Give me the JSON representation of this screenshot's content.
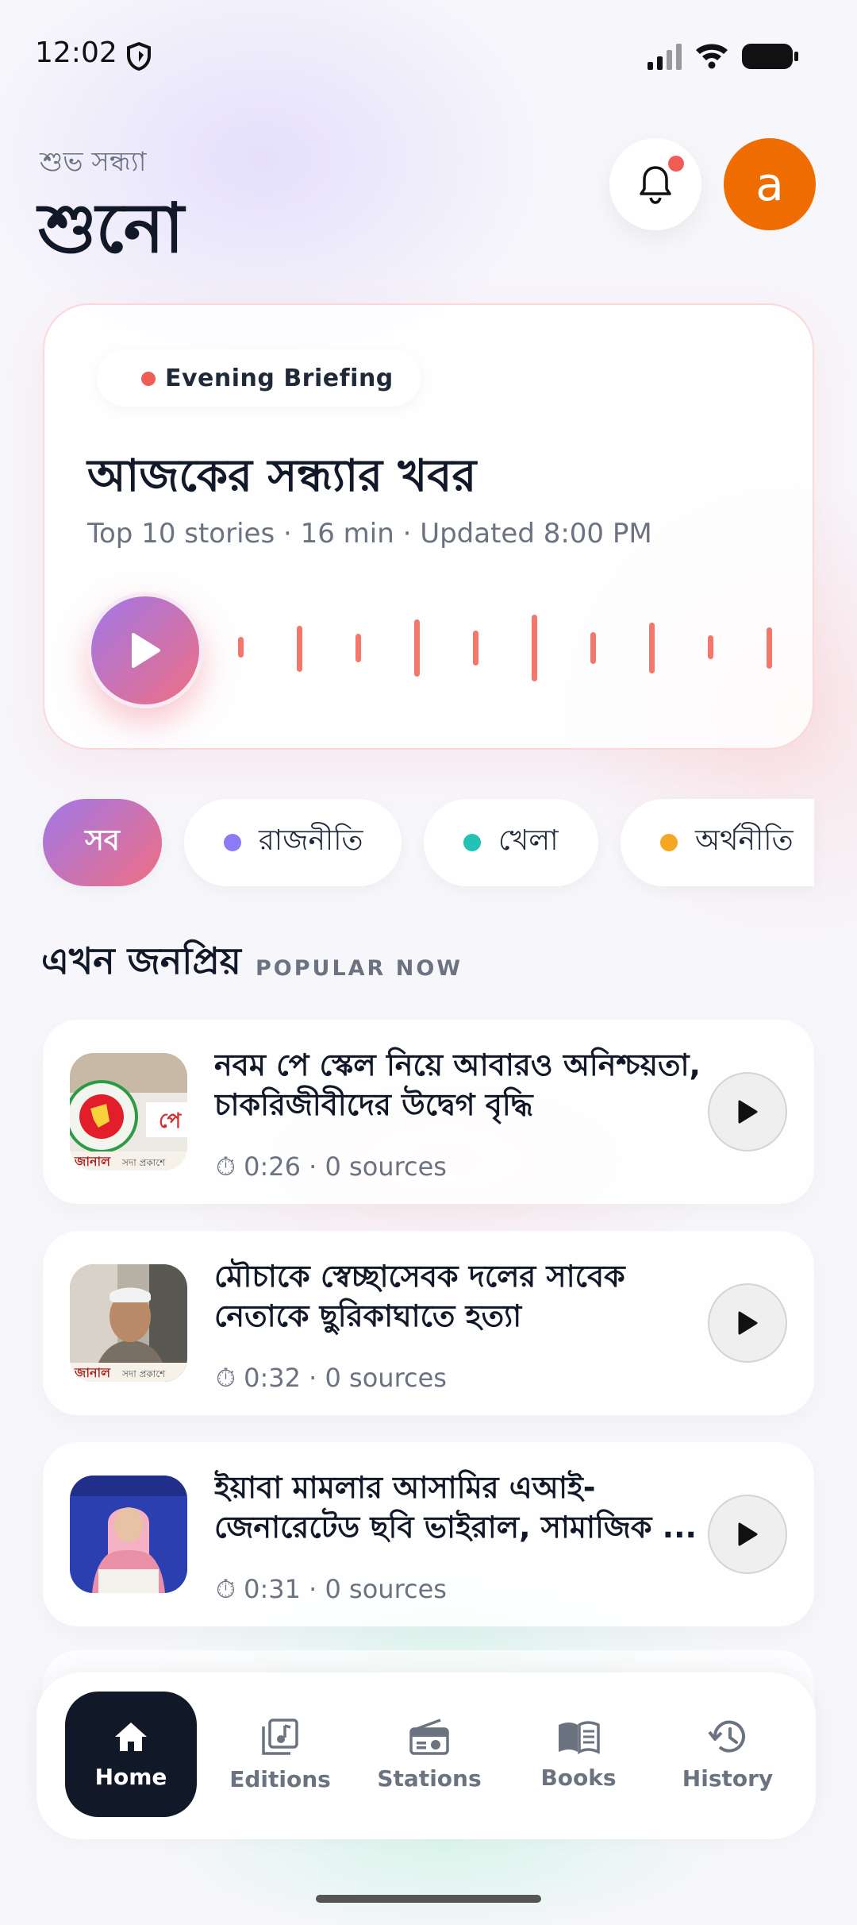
{
  "status_bar": {
    "time": "12:02"
  },
  "header": {
    "greeting": "শুভ সন্ধ্যা",
    "title": "শুনো",
    "avatar_letter": "a"
  },
  "briefing": {
    "badge": "Evening Briefing",
    "title": "আজকের সন্ধ্যার খবর",
    "meta": "Top 10 stories · 16 min · Updated 8:00 PM",
    "accent": "#f05d57"
  },
  "categories": [
    {
      "label": "সব",
      "active": true
    },
    {
      "label": "রাজনীতি",
      "dot_color": "#8b7cf6"
    },
    {
      "label": "খেলা",
      "dot_color": "#22c3b4"
    },
    {
      "label": "অর্থনীতি",
      "dot_color": "#f5a623"
    }
  ],
  "section": {
    "title": "এখন জনপ্রিয়",
    "subtitle": "POPULAR NOW"
  },
  "news": [
    {
      "title": "নবম পে স্কেল নিয়ে আবারও অনিশ্চয়তা, চাকরিজীবীদের উদ্বেগ বৃদ্ধি",
      "meta": "⏱ 0:26 · 0 sources"
    },
    {
      "title": "মৌচাকে স্বেচ্ছাসেবক দলের সাবেক নেতাকে ছুরিকাঘাতে হত্যা",
      "meta": "⏱ 0:32 · 0 sources"
    },
    {
      "title": "ইয়াবা মামলার আসামির এআই-জেনারেটেড ছবি ভাইরাল, সামাজিক ...",
      "meta": "⏱ 0:31 · 0 sources"
    }
  ],
  "bottom_nav": [
    {
      "label": "Home",
      "icon": "home-icon",
      "active": true
    },
    {
      "label": "Editions",
      "icon": "music-note-icon"
    },
    {
      "label": "Stations",
      "icon": "radio-icon"
    },
    {
      "label": "Books",
      "icon": "book-icon"
    },
    {
      "label": "History",
      "icon": "history-icon"
    }
  ]
}
